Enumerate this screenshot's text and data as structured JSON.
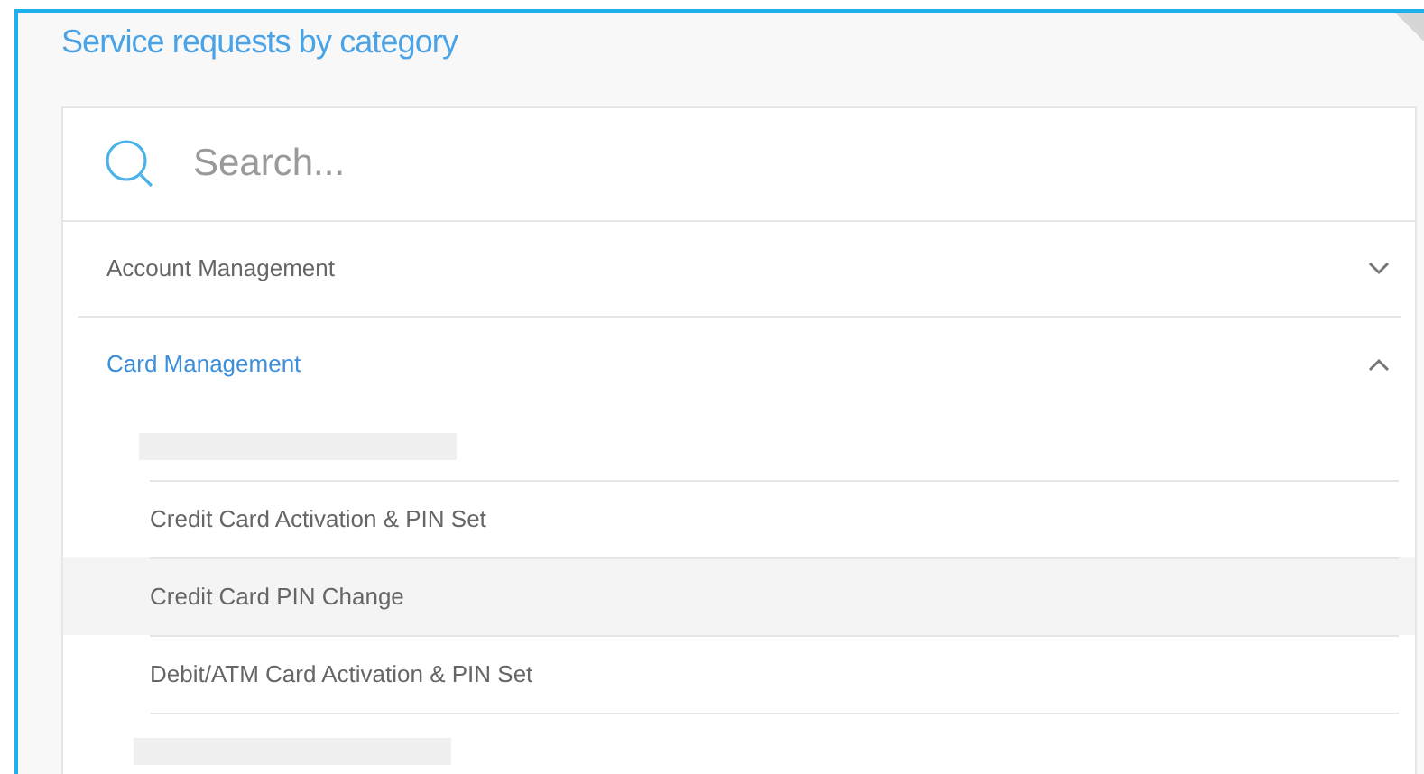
{
  "title": "Service requests by category",
  "search": {
    "placeholder": "Search..."
  },
  "categories": [
    {
      "label": "Account Management",
      "expanded": false
    },
    {
      "label": "Card Management",
      "expanded": true,
      "children": [
        {
          "kind": "placeholder",
          "selected": false
        },
        {
          "kind": "link",
          "label": "Credit Card Activation & PIN Set",
          "selected": false
        },
        {
          "kind": "link",
          "label": "Credit Card PIN Change",
          "selected": true
        },
        {
          "kind": "link",
          "label": "Debit/ATM Card Activation & PIN Set",
          "selected": false
        },
        {
          "kind": "placeholder",
          "selected": false
        }
      ]
    }
  ]
}
